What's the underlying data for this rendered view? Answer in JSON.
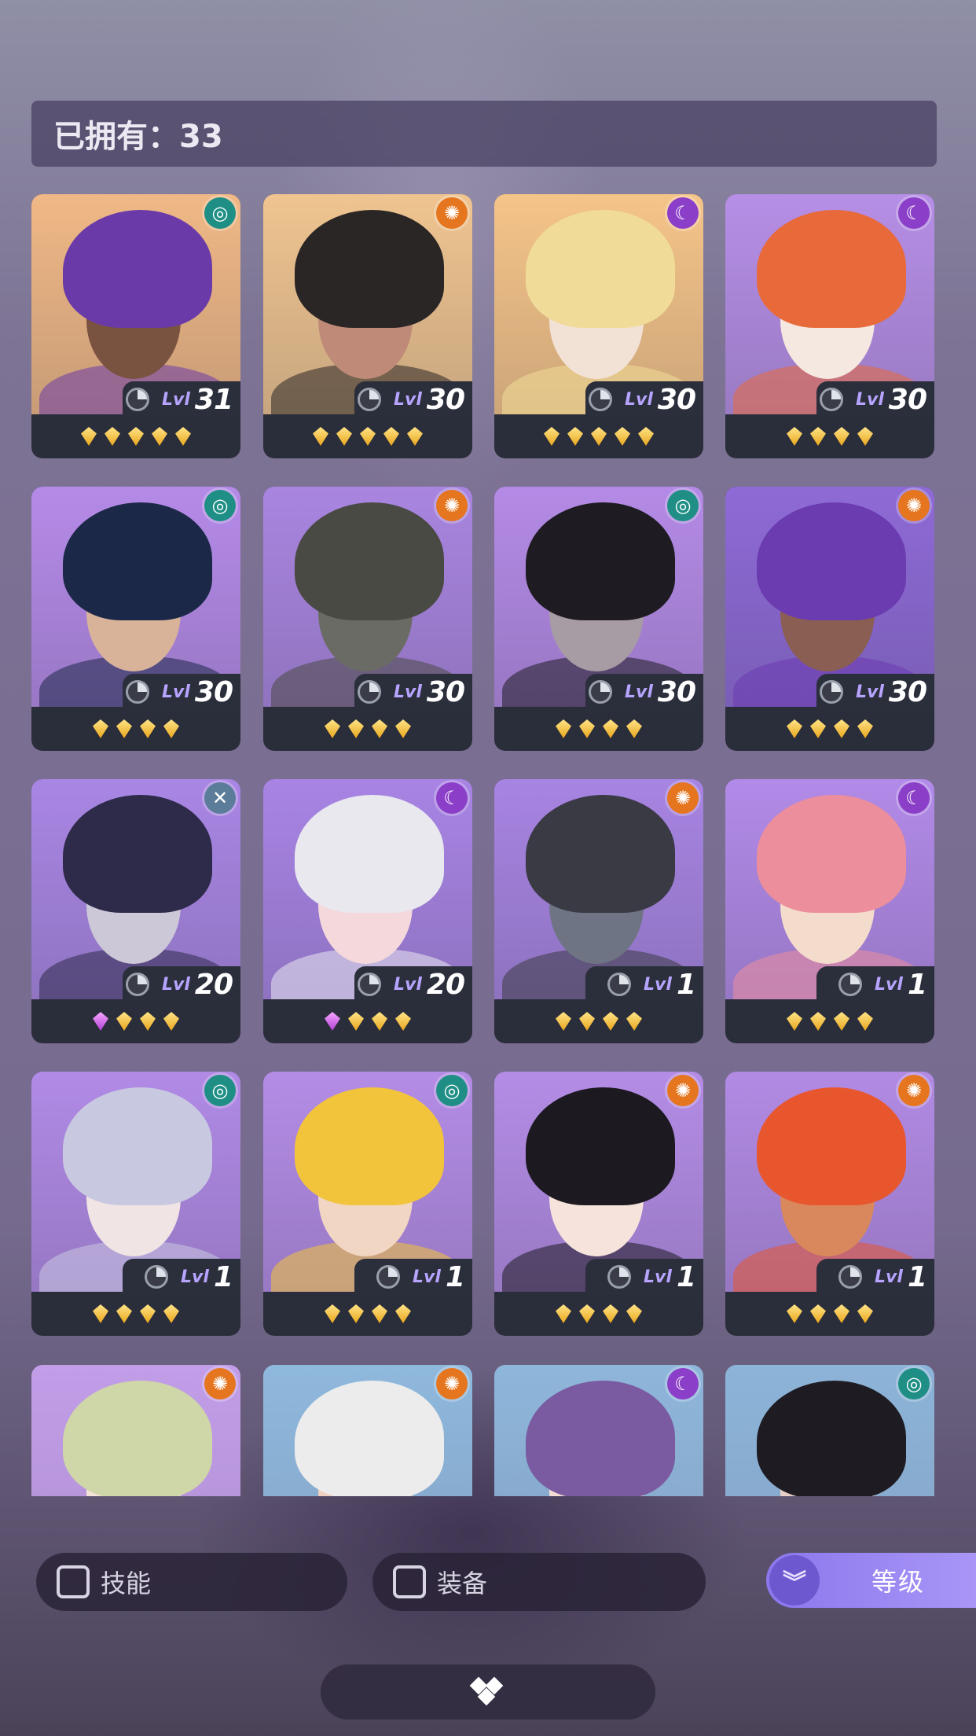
{
  "owned": {
    "text": "已拥有：33"
  },
  "cards": [
    {
      "element": "wind",
      "level": "31",
      "stars": [
        "gold",
        "gold",
        "gold",
        "gold",
        "gold"
      ],
      "bg": "#f0b886",
      "hair": "#6a3ba8",
      "skin": "#7a5240"
    },
    {
      "element": "sun",
      "level": "30",
      "stars": [
        "gold",
        "gold",
        "gold",
        "gold",
        "gold"
      ],
      "bg": "#efc490",
      "hair": "#2a2626",
      "skin": "#c08a78"
    },
    {
      "element": "moon",
      "level": "30",
      "stars": [
        "gold",
        "gold",
        "gold",
        "gold",
        "gold"
      ],
      "bg": "#f5c489",
      "hair": "#f0dc98",
      "skin": "#f2e2d6"
    },
    {
      "element": "moon",
      "level": "30",
      "stars": [
        "gold",
        "gold",
        "gold",
        "gold"
      ],
      "bg": "#b68ee6",
      "hair": "#e86a3a",
      "skin": "#f4e8e0"
    },
    {
      "element": "wind",
      "level": "30",
      "stars": [
        "gold",
        "gold",
        "gold",
        "gold"
      ],
      "bg": "#b58ae8",
      "hair": "#1c2848",
      "skin": "#d8b39a"
    },
    {
      "element": "sun",
      "level": "30",
      "stars": [
        "gold",
        "gold",
        "gold",
        "gold"
      ],
      "bg": "#a985e0",
      "hair": "#4a4a44",
      "skin": "#6b6b66"
    },
    {
      "element": "wind",
      "level": "30",
      "stars": [
        "gold",
        "gold",
        "gold",
        "gold"
      ],
      "bg": "#b48ae6",
      "hair": "#1e1c22",
      "skin": "#a89ca4"
    },
    {
      "element": "sun",
      "level": "30",
      "stars": [
        "gold",
        "gold",
        "gold",
        "gold"
      ],
      "bg": "#8e6ad6",
      "hair": "#6b3bb0",
      "skin": "#8a5e52"
    },
    {
      "element": "void",
      "level": "20",
      "stars": [
        "purple",
        "gold",
        "gold",
        "gold"
      ],
      "bg": "#a986e4",
      "hair": "#2e2a4a",
      "skin": "#cdc8d8"
    },
    {
      "element": "moon",
      "level": "20",
      "stars": [
        "purple",
        "gold",
        "gold",
        "gold"
      ],
      "bg": "#a884e4",
      "hair": "#e8e8ee",
      "skin": "#f4d8dc"
    },
    {
      "element": "sun",
      "level": "1",
      "stars": [
        "gold",
        "gold",
        "gold",
        "gold"
      ],
      "bg": "#a784e2",
      "hair": "#3a3a44",
      "skin": "#6e7484"
    },
    {
      "element": "moon",
      "level": "1",
      "stars": [
        "gold",
        "gold",
        "gold",
        "gold"
      ],
      "bg": "#b28ae8",
      "hair": "#ec8e9c",
      "skin": "#f4dccc"
    },
    {
      "element": "wind",
      "level": "1",
      "stars": [
        "gold",
        "gold",
        "gold",
        "gold"
      ],
      "bg": "#b18ae6",
      "hair": "#c8c8e0",
      "skin": "#f0e4e4"
    },
    {
      "element": "wind",
      "level": "1",
      "stars": [
        "gold",
        "gold",
        "gold",
        "gold"
      ],
      "bg": "#b48ce6",
      "hair": "#f2c43c",
      "skin": "#f2d6c4"
    },
    {
      "element": "sun",
      "level": "1",
      "stars": [
        "gold",
        "gold",
        "gold",
        "gold"
      ],
      "bg": "#b48ce6",
      "hair": "#1c1a20",
      "skin": "#f6e4dc"
    },
    {
      "element": "sun",
      "level": "1",
      "stars": [
        "gold",
        "gold",
        "gold",
        "gold"
      ],
      "bg": "#b28ae4",
      "hair": "#e8562e",
      "skin": "#d8885c"
    },
    {
      "element": "sun",
      "level": "",
      "stars": [],
      "bg": "#c29de8",
      "hair": "#cfd6a8",
      "skin": "#f4e4d8"
    },
    {
      "element": "sun",
      "level": "",
      "stars": [],
      "bg": "#8eb8dc",
      "hair": "#ececec",
      "skin": "#f0d0c0"
    },
    {
      "element": "moon",
      "level": "",
      "stars": [],
      "bg": "#8eb6da",
      "hair": "#7a5aa0",
      "skin": "#f4dcd4"
    },
    {
      "element": "wind",
      "level": "",
      "stars": [],
      "bg": "#8cb4d8",
      "hair": "#1e1c22",
      "skin": "#e8d0c8"
    }
  ],
  "level_prefix": "Lvl",
  "filters": {
    "skill": "技能",
    "equipment": "装备"
  },
  "sort": {
    "label": "等级",
    "icon": "chevron-double-down-icon"
  },
  "element_colors": {
    "wind": "#1f8f86",
    "sun": "#e5761f",
    "moon": "#8b3fc8",
    "void": "#5b7d9a"
  },
  "element_glyphs": {
    "wind": "◎",
    "sun": "✺",
    "moon": "☾",
    "void": "✕"
  }
}
